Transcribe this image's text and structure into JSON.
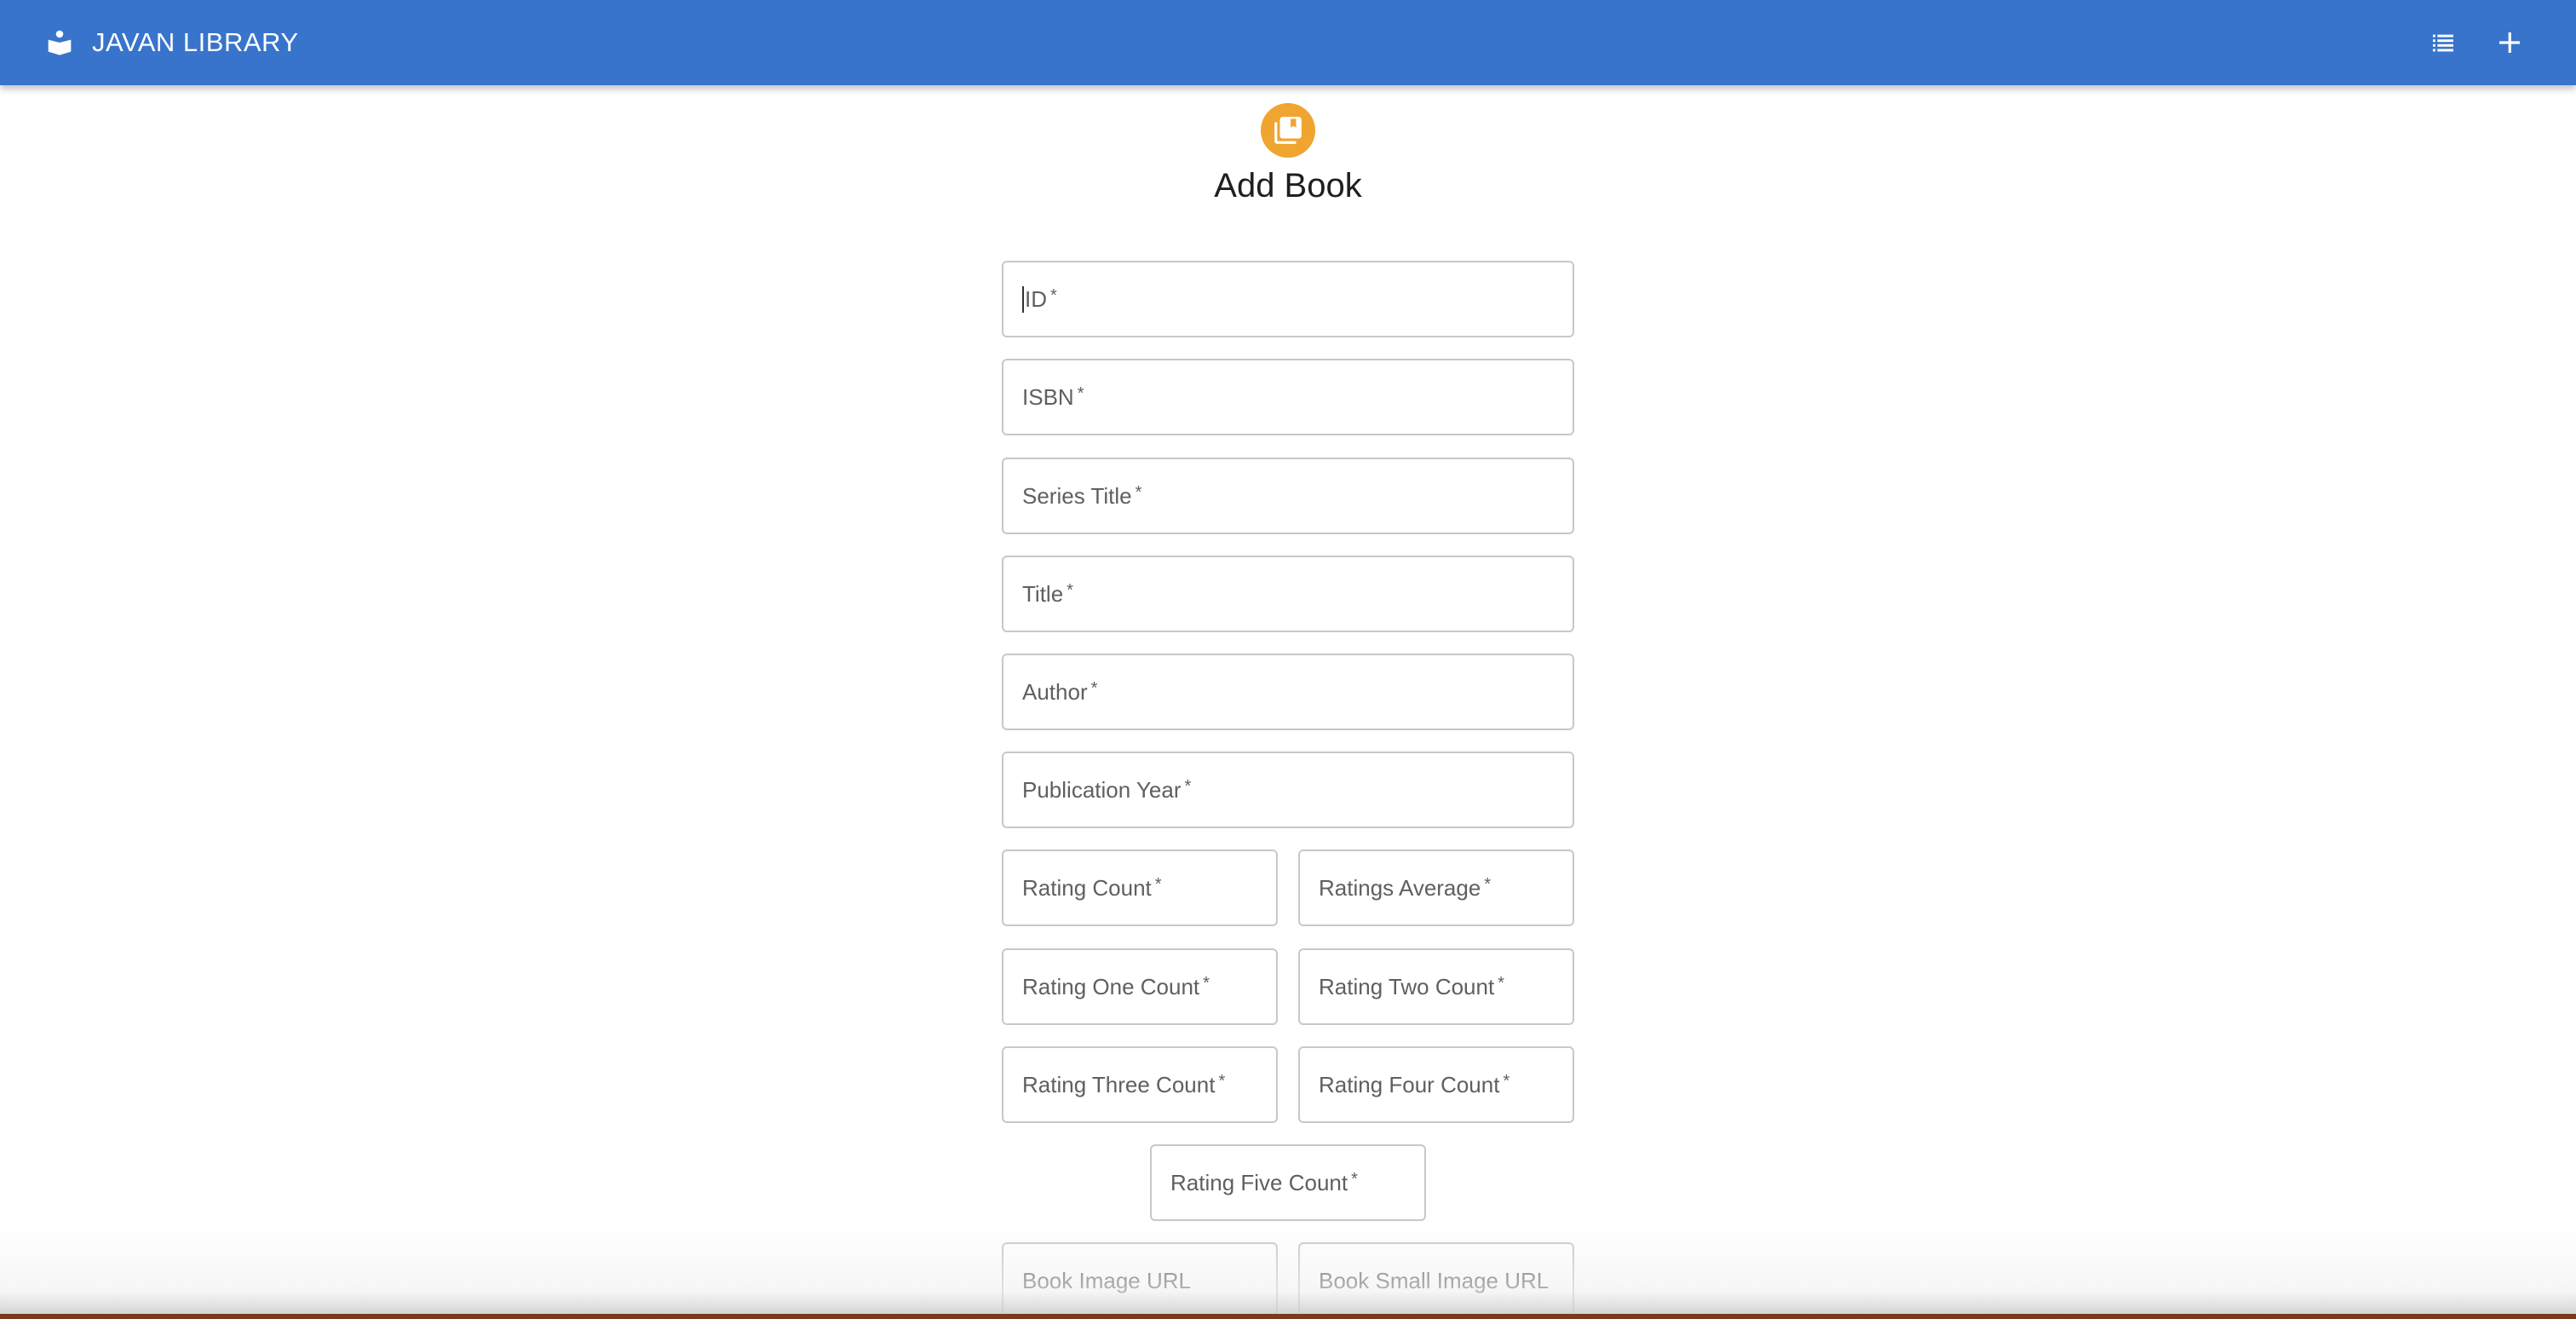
{
  "app": {
    "title": "JAVAN LIBRARY",
    "brand_icon": "reader-book-icon",
    "brand_color": "#3874cb",
    "actions": [
      {
        "name": "book-list-icon",
        "label": "list"
      },
      {
        "name": "add-icon",
        "label": "add"
      }
    ]
  },
  "form": {
    "avatar_icon": "library-books-icon",
    "avatar_color": "#f0a530",
    "title": "Add Book",
    "fields": {
      "id": {
        "label": "ID",
        "required": "*"
      },
      "isbn": {
        "label": "ISBN",
        "required": "*"
      },
      "series_title": {
        "label": "Series Title",
        "required": "*"
      },
      "title": {
        "label": "Title",
        "required": "*"
      },
      "author": {
        "label": "Author",
        "required": "*"
      },
      "publication_year": {
        "label": "Publication Year",
        "required": "*"
      },
      "rating_count": {
        "label": "Rating Count",
        "required": "*"
      },
      "ratings_average": {
        "label": "Ratings Average",
        "required": "*"
      },
      "rating_one_count": {
        "label": "Rating One Count",
        "required": "*"
      },
      "rating_two_count": {
        "label": "Rating Two Count",
        "required": "*"
      },
      "rating_three_count": {
        "label": "Rating Three Count",
        "required": "*"
      },
      "rating_four_count": {
        "label": "Rating Four Count",
        "required": "*"
      },
      "rating_five_count": {
        "label": "Rating Five Count",
        "required": "*"
      },
      "book_image_url": {
        "label": "Book Image URL"
      },
      "book_small_image_url": {
        "label": "Book Small Image URL"
      }
    }
  }
}
